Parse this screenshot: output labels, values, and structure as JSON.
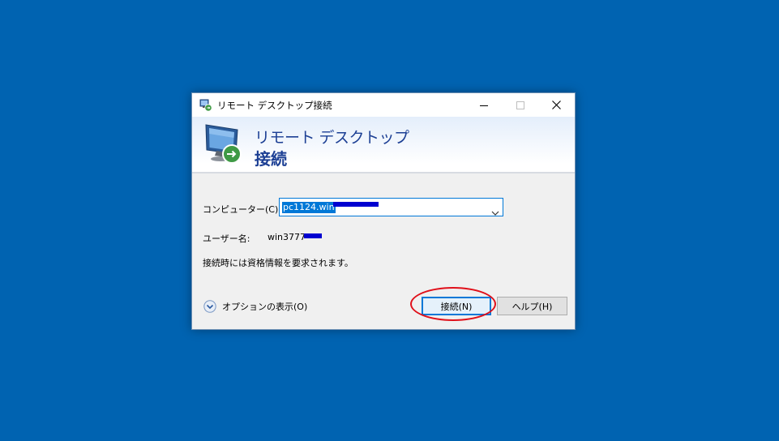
{
  "window": {
    "title": "リモート デスクトップ接続",
    "minimize_icon": "minimize-icon",
    "maximize_icon": "maximize-icon",
    "close_icon": "close-icon"
  },
  "banner": {
    "line1": "リモート デスクトップ",
    "line2": "接続"
  },
  "form": {
    "computer_label": "コンピューター(C):",
    "computer_value": "pc1124.win",
    "username_label": "ユーザー名:",
    "username_value": "win3777",
    "info_text": "接続時には資格情報を要求されます。"
  },
  "footer": {
    "options_label": "オプションの表示(O)",
    "connect_label": "接続(N)",
    "help_label": "ヘルプ(H)"
  },
  "colors": {
    "desktop": "#0063b1",
    "accent": "#0078d7",
    "banner_text": "#1c3f94",
    "annotation": "#e0101a",
    "redaction": "#0000d0"
  }
}
